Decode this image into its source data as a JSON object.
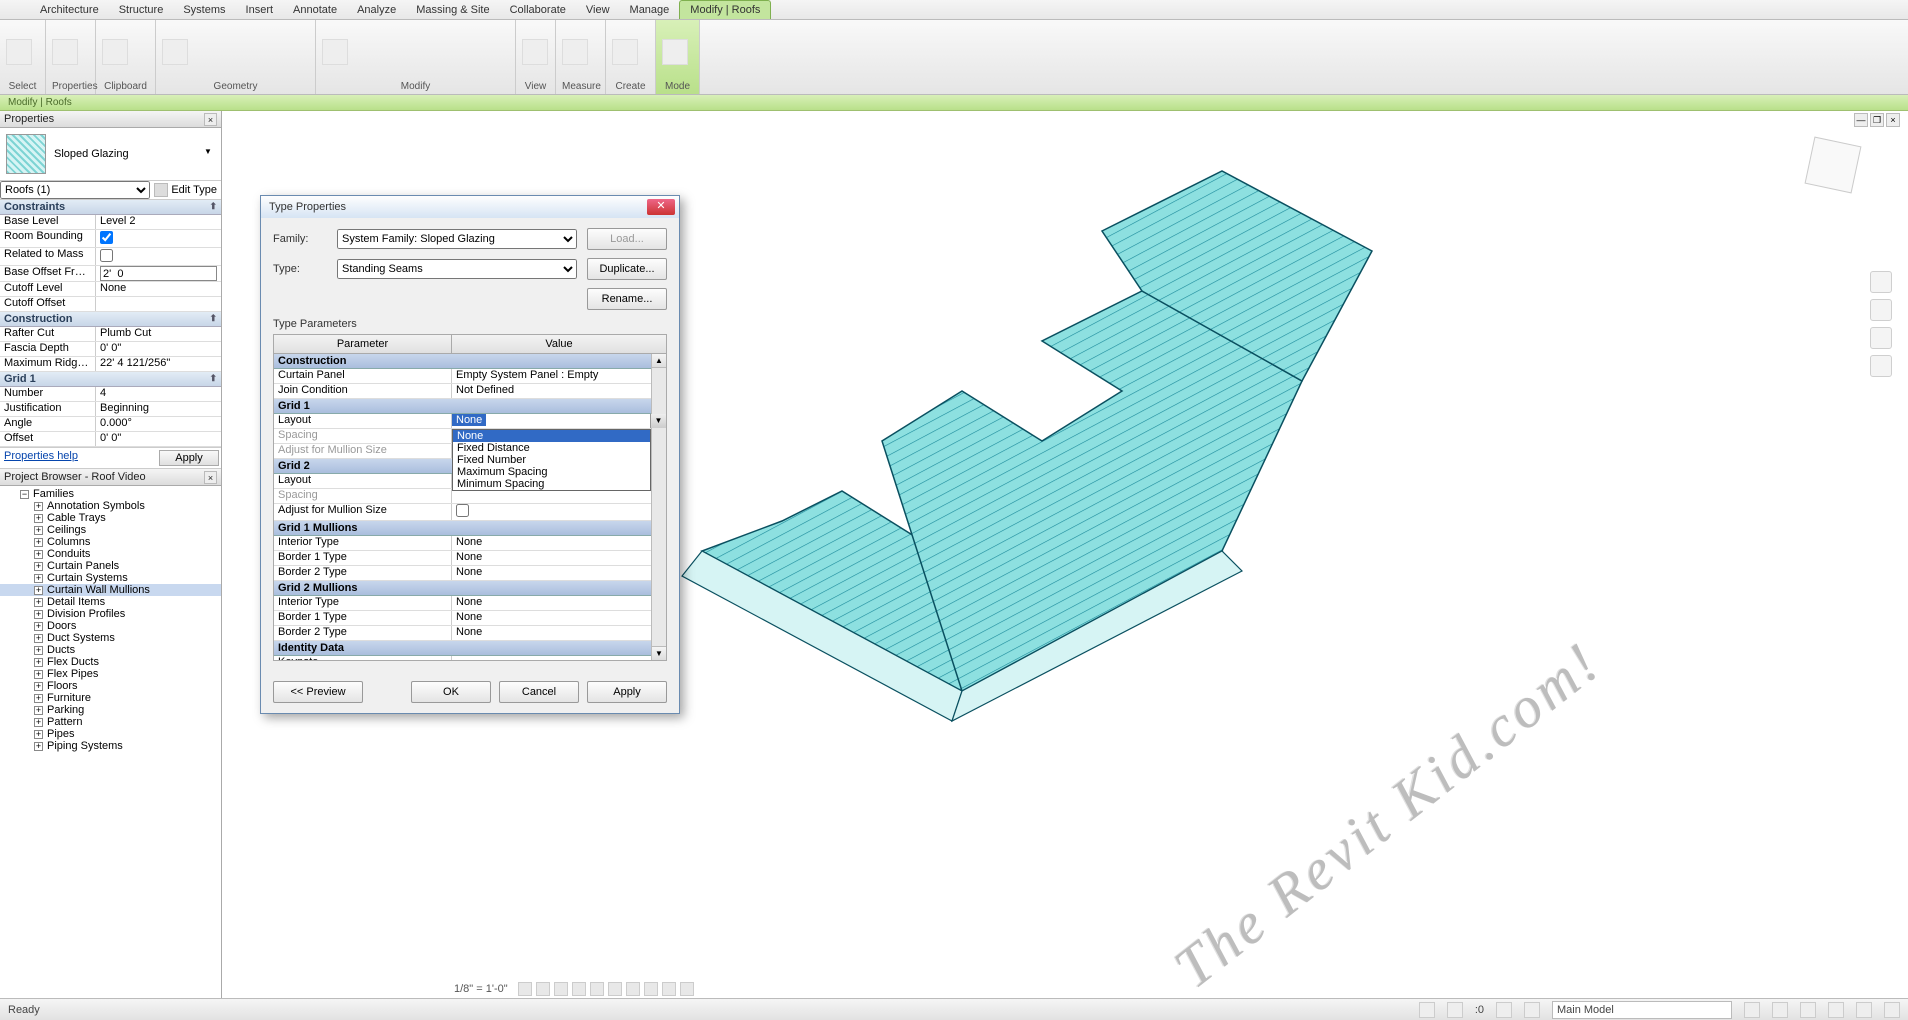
{
  "tabs": [
    "Architecture",
    "Structure",
    "Systems",
    "Insert",
    "Annotate",
    "Analyze",
    "Massing & Site",
    "Collaborate",
    "View",
    "Manage",
    "Modify | Roofs"
  ],
  "activeTab": 10,
  "contextLabel": "Modify | Roofs",
  "ribbonGroups": [
    "Select",
    "Properties",
    "Clipboard",
    "Geometry",
    "Modify",
    "View",
    "Measure",
    "Create",
    "Mode"
  ],
  "propsPanel": {
    "title": "Properties",
    "typeName": "Sloped Glazing",
    "selector": "Roofs (1)",
    "editType": "Edit Type",
    "groups": [
      {
        "name": "Constraints",
        "rows": [
          {
            "n": "Base Level",
            "v": "Level 2"
          },
          {
            "n": "Room Bounding",
            "v": "[x]",
            "chk": true,
            "checked": true
          },
          {
            "n": "Related to Mass",
            "v": "",
            "chk": true,
            "checked": false
          },
          {
            "n": "Base Offset From L...",
            "v": "2'  0\"",
            "input": true
          },
          {
            "n": "Cutoff Level",
            "v": "None"
          },
          {
            "n": "Cutoff Offset",
            "v": ""
          }
        ]
      },
      {
        "name": "Construction",
        "rows": [
          {
            "n": "Rafter Cut",
            "v": "Plumb Cut"
          },
          {
            "n": "Fascia Depth",
            "v": "0'  0\""
          },
          {
            "n": "Maximum Ridge H...",
            "v": "22'  4 121/256\""
          }
        ]
      },
      {
        "name": "Grid 1",
        "rows": [
          {
            "n": "Number",
            "v": "4"
          },
          {
            "n": "Justification",
            "v": "Beginning"
          },
          {
            "n": "Angle",
            "v": "0.000°"
          },
          {
            "n": "Offset",
            "v": "0'  0\""
          }
        ]
      }
    ],
    "helpLink": "Properties help",
    "applyBtn": "Apply"
  },
  "browser": {
    "title": "Project Browser - Roof Video",
    "root": "Families",
    "nodes": [
      "Annotation Symbols",
      "Cable Trays",
      "Ceilings",
      "Columns",
      "Conduits",
      "Curtain Panels",
      "Curtain Systems",
      "Curtain Wall Mullions",
      "Detail Items",
      "Division Profiles",
      "Doors",
      "Duct Systems",
      "Ducts",
      "Flex Ducts",
      "Flex Pipes",
      "Floors",
      "Furniture",
      "Parking",
      "Pattern",
      "Pipes",
      "Piping Systems"
    ],
    "selected": "Curtain Wall Mullions"
  },
  "dialog": {
    "title": "Type Properties",
    "familyLbl": "Family:",
    "family": "System Family: Sloped Glazing",
    "typeLbl": "Type:",
    "type": "Standing Seams",
    "loadBtn": "Load...",
    "dupBtn": "Duplicate...",
    "renBtn": "Rename...",
    "tpLabel": "Type Parameters",
    "colParam": "Parameter",
    "colValue": "Value",
    "groups": [
      {
        "name": "Construction",
        "rows": [
          {
            "n": "Curtain Panel",
            "v": "Empty System Panel : Empty"
          },
          {
            "n": "Join Condition",
            "v": "Not Defined"
          }
        ]
      },
      {
        "name": "Grid 1",
        "rows": [
          {
            "n": "Layout",
            "v": "None",
            "combo": true
          },
          {
            "n": "Spacing",
            "v": "",
            "disabled": true
          },
          {
            "n": "Adjust for Mullion Size",
            "v": "",
            "disabled": true
          }
        ]
      },
      {
        "name": "Grid 2",
        "rows": [
          {
            "n": "Layout",
            "v": ""
          },
          {
            "n": "Spacing",
            "v": "",
            "disabled": true
          },
          {
            "n": "Adjust for Mullion Size",
            "v": "",
            "chk": true
          }
        ]
      },
      {
        "name": "Grid 1 Mullions",
        "rows": [
          {
            "n": "Interior Type",
            "v": "None"
          },
          {
            "n": "Border 1 Type",
            "v": "None"
          },
          {
            "n": "Border 2 Type",
            "v": "None"
          }
        ]
      },
      {
        "name": "Grid 2 Mullions",
        "rows": [
          {
            "n": "Interior Type",
            "v": "None"
          },
          {
            "n": "Border 1 Type",
            "v": "None"
          },
          {
            "n": "Border 2 Type",
            "v": "None"
          }
        ]
      },
      {
        "name": "Identity Data",
        "rows": [
          {
            "n": "Keynote",
            "v": ""
          }
        ]
      }
    ],
    "ddOptions": [
      "None",
      "Fixed Distance",
      "Fixed Number",
      "Maximum Spacing",
      "Minimum Spacing"
    ],
    "previewBtn": "<< Preview",
    "okBtn": "OK",
    "cancelBtn": "Cancel",
    "applyBtn": "Apply"
  },
  "viewScale": "1/8\" = 1'-0\"",
  "watermark": "The Revit Kid.com!",
  "status": {
    "ready": "Ready",
    "zero": ":0",
    "model": "Main Model"
  }
}
